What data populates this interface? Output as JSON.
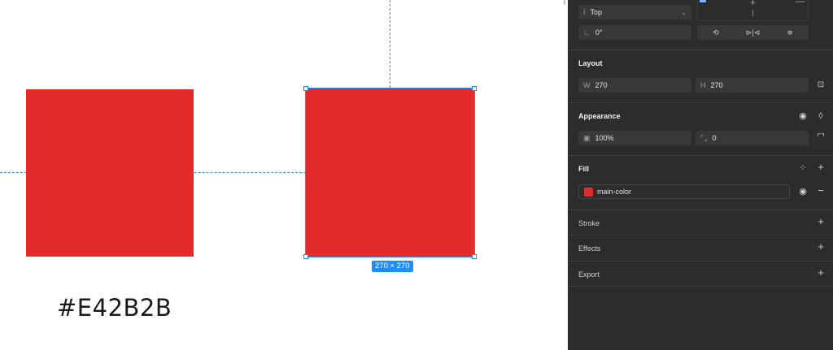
{
  "canvas": {
    "left_rect_color": "#E42B2B",
    "selected_rect_color": "#E42B2B",
    "size_badge": "270 × 270",
    "hex_label": "#E42B2B"
  },
  "panel": {
    "constraint": {
      "vertical_value": "Top",
      "icon": "text-cursor-icon"
    },
    "rotation": {
      "value": "0°"
    },
    "layout": {
      "title": "Layout",
      "width_label": "W",
      "width": "270",
      "height_label": "H",
      "height": "270"
    },
    "appearance": {
      "title": "Appearance",
      "opacity": "100%",
      "corner_radius": "0"
    },
    "fill": {
      "title": "Fill",
      "style_name": "main-color",
      "color": "#E42B2B"
    },
    "stroke": {
      "title": "Stroke"
    },
    "effects": {
      "title": "Effects"
    },
    "export": {
      "title": "Export"
    }
  },
  "colors": {
    "panel_bg": "#2c2c2c",
    "accent": "#1f8fff",
    "guide": "#3b8fe8"
  }
}
